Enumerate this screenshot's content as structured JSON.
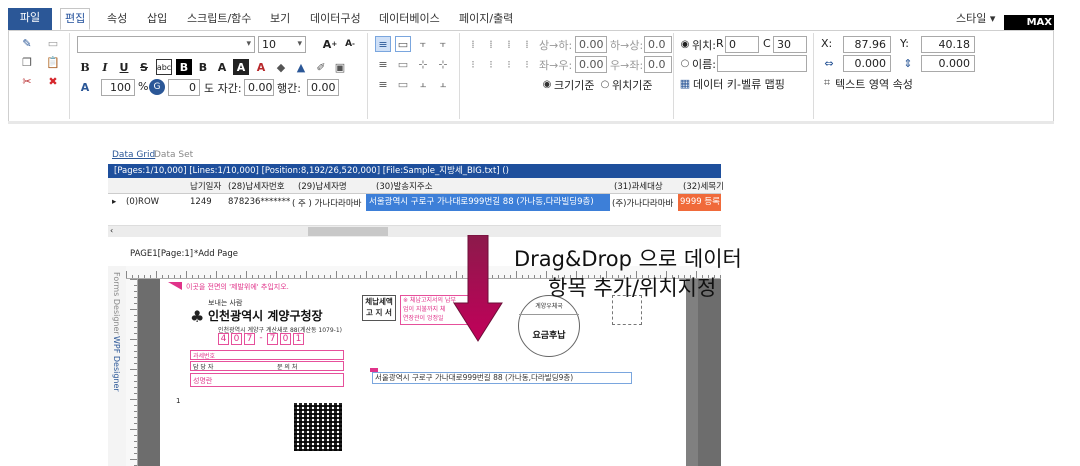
{
  "ribbon": {
    "tabs": [
      "파일",
      "편집",
      "속성",
      "삽입",
      "스크립트/함수",
      "보기",
      "데이터구성",
      "데이터베이스",
      "페이지/출력"
    ],
    "style_label": "스타일",
    "style_value": "MAX",
    "font_size": "10",
    "zoom_value": "100",
    "zoom_unit": "%",
    "char_spacing_value": "0",
    "char_spacing_label": "도 자간:",
    "char_spacing_num": "0.00",
    "line_spacing_label": "행간:",
    "line_spacing_num": "0.00",
    "align_fields": [
      {
        "label": "상→하:",
        "value": "0.00"
      },
      {
        "label": "하→상:",
        "value": "0.0"
      },
      {
        "label": "좌→우:",
        "value": "0.00"
      },
      {
        "label": "우→좌:",
        "value": "0.0"
      }
    ],
    "size_base": "크기기준",
    "pos_base": "위치기준",
    "position_label": "위치:",
    "r_label": "R",
    "r_value": "0",
    "c_label": "C",
    "c_value": "30",
    "name_label": "이름:",
    "mapping_label": "데이터 키-벨류 맵핑",
    "x_label": "X:",
    "x_value": "87.96",
    "y_label": "Y:",
    "y_value": "40.18",
    "w_value": "0.000",
    "h_value": "0.000",
    "text_area_label": "텍스트 영역 속성"
  },
  "grid": {
    "tabs": [
      "Data Grid",
      "Data Set"
    ],
    "status": "[Pages:1/10,000] [Lines:1/10,000] [Position:8,192/26,520,000] [File:Sample_지방세_BIG.txt] ()",
    "headers": [
      "납기일자",
      "(28)납세자번호",
      "(29)납세자명",
      "(30)발송지주소",
      "(31)과세대상",
      "(32)세목기"
    ],
    "row_marker": "▸",
    "row_label": "(0)ROW",
    "row": [
      "1249",
      "878236*******",
      "( 주 ) 가나다라마바",
      "서울광역시 구로구 가나대로999번길 88 (가나동,다라빌딩9층)",
      "(주)가나다라마바",
      "9999 등록"
    ]
  },
  "designer": {
    "page_tab": "PAGE1[Page:1]",
    "add_page": "*Add Page",
    "side_labels": [
      "Forms Designer",
      "WPF Designer"
    ],
    "hint_text": "이곳을 전면의 '제발위에' 추입지오.",
    "sender_label": "보내는 사람",
    "sender_name": "인천광역시 계양구청장",
    "sender_addr1": "인천광역시 계양구 계산새로 88(계산동 1079-1)",
    "zip_digits": [
      "4",
      "0",
      "7",
      "-",
      "7",
      "0",
      "1"
    ],
    "tax_box": "체납세액\n고 지 서",
    "notice_text": "※ 체납고지서의 납부\n업이 지불까지 체\n연장관이 엉정일",
    "postmark_top": "계양우체국",
    "postmark_bottom": "요금후납",
    "form_row1": "과세번호",
    "form_row2a": "담 당 자",
    "form_row2b": "문 의 처",
    "form_row3": "성명란",
    "page_number": "1",
    "address_field": "서울광역시 구로구 가나대로999번길 88 (가나동,다라빌딩9층)"
  },
  "caption": {
    "line1": "Drag&Drop 으로 데이터",
    "line2": "항목 추가/위치지정"
  },
  "colors": {
    "ribbon_blue": "#2b5797",
    "status_blue": "#1e4f9c",
    "accent_pink": "#e0338a",
    "arrow_magenta": "#b5004f",
    "selected_cell": "#3d7fd8",
    "orange_cell": "#f06a3a"
  }
}
